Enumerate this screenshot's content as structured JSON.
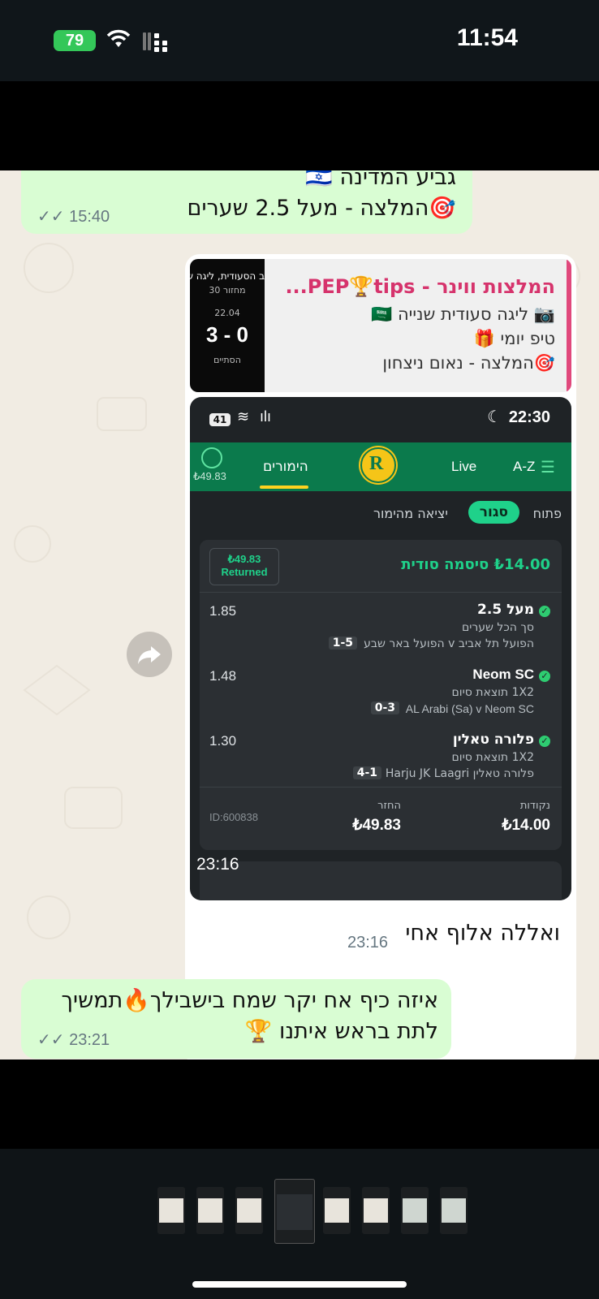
{
  "status_bar": {
    "battery": "79",
    "time": "11:54"
  },
  "messages": {
    "m1": {
      "line1": "גביע המדינה 🇮🇱",
      "line2": "🎯המלצה - מעל 2.5 שערים",
      "time": "15:40"
    },
    "reply_card": {
      "title": "המלצות ווינר - PEP🏆tips...",
      "line1": "📷 ליגה סעודית שנייה 🇸🇦",
      "line2": "טיפ יומי 🎁",
      "line3": "🎯המלצה - נאום ניצחון",
      "score_header": "ב הסעודית, ליגה ש",
      "score_round": "מחזור 30",
      "score_date": "22.04",
      "score": "3 - 0",
      "score_status": "הסתיים"
    },
    "bet_shot": {
      "status_time": "22:30",
      "status_battery": "41",
      "nav": {
        "az": "A-Z",
        "live": "Live",
        "bets": "הימורים",
        "balance": "₺49.83"
      },
      "filters": {
        "open": "פתוח",
        "closed": "סגור",
        "cashout": "יציאה מהימור"
      },
      "ticket": {
        "title": "₺14.00 סיסמה סודית",
        "returned_amount": "₺49.83",
        "returned_label": "Returned",
        "legs": [
          {
            "title": "מעל 2.5",
            "market": "סך הכל שערים",
            "match": "הפועל תל אביב v הפועל באר שבע",
            "score": "1-5",
            "odds": "1.85"
          },
          {
            "title": "Neom SC",
            "market": "1X2 תוצאת סיום",
            "match": "AL Arabi (Sa) v Neom SC",
            "score": "0-3",
            "odds": "1.48"
          },
          {
            "title": "פלורה טאלין",
            "market": "1X2 תוצאת סיום",
            "match": "פלורה טאלין v Harju JK Laagri",
            "score": "4-1",
            "odds": "1.30"
          }
        ],
        "stake_label": "נקודות",
        "stake": "₺14.00",
        "return_label": "החזר",
        "return_value": "₺49.83",
        "id": "ID:600838"
      },
      "time": "23:16"
    },
    "m3": {
      "text": "ואללה אלוף אחי",
      "time": "23:16"
    },
    "m4": {
      "line1": "איזה כיף אח יקר שמח בישבילך🔥תמשיך",
      "line2": "לתת בראש איתנו 🏆",
      "time": "23:21"
    }
  },
  "colors": {
    "bubble_out": "#d9fdd3",
    "bubble_in": "#ffffff",
    "accent_green": "#0b7a4c",
    "check_green": "#2ecc71"
  }
}
